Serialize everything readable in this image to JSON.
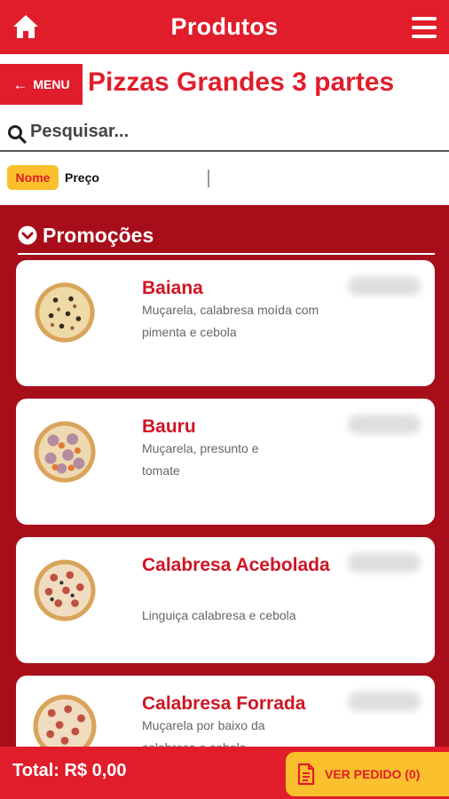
{
  "header": {
    "title": "Produtos",
    "home_icon": "home-icon",
    "menu_icon": "hamburger-menu-icon"
  },
  "nav": {
    "menu_label": "MENU",
    "back_icon": "arrow-left-icon",
    "page_title": "Pizzas Grandes 3 partes"
  },
  "search": {
    "placeholder": "Pesquisar...",
    "value": ""
  },
  "sort": {
    "active": "Nome",
    "other": "Preço"
  },
  "section": {
    "label": "Promoções"
  },
  "products": [
    {
      "name": "Baiana",
      "description": "Muçarela, calabresa moída com pimenta e cebola"
    },
    {
      "name": "Bauru",
      "description": "Muçarela, presunto e tomate"
    },
    {
      "name": "Calabresa Acebolada",
      "description": "Linguiça calabresa e cebola"
    },
    {
      "name": "Calabresa Forrada",
      "description": "Muçarela por baixo da calabresa e cebola"
    }
  ],
  "footer": {
    "total": "Total: R$ 0,00",
    "order_button": "VER PEDIDO (0)"
  },
  "colors": {
    "brand_red": "#e11d2b",
    "dark_red": "#a80d1a",
    "accent_yellow": "#fbc02d"
  }
}
